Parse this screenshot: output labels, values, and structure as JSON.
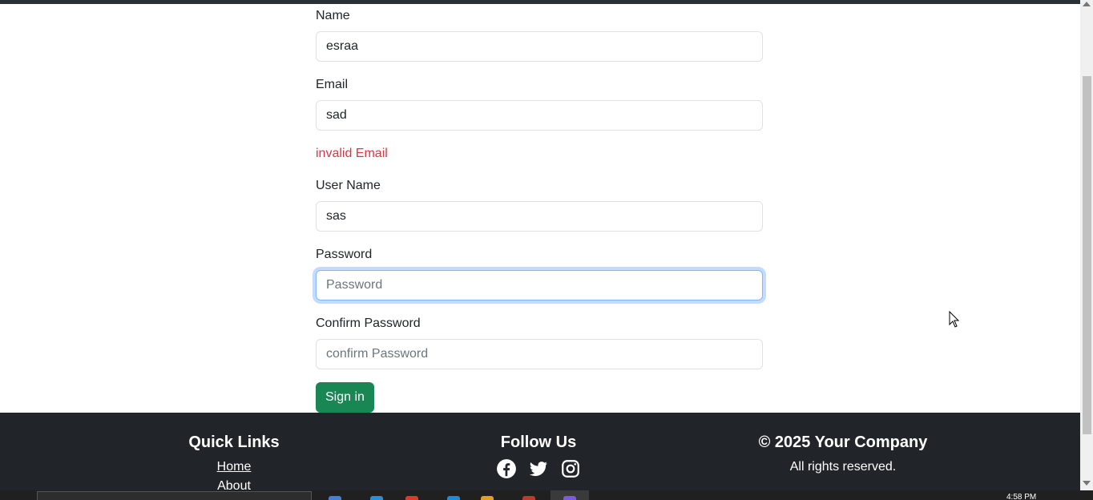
{
  "form": {
    "name_label": "Name",
    "name_value": "esraa",
    "email_label": "Email",
    "email_value": "sad",
    "email_error": "invalid Email",
    "username_label": "User Name",
    "username_value": "sas",
    "password_label": "Password",
    "password_placeholder": "Password",
    "confirm_label": "Confirm Password",
    "confirm_placeholder": "confirm Password",
    "submit_label": "Sign in"
  },
  "footer": {
    "quick_links_title": "Quick Links",
    "links": [
      "Home",
      "About"
    ],
    "follow_title": "Follow Us",
    "social_icons": [
      "facebook-icon",
      "twitter-icon",
      "instagram-icon"
    ],
    "copyright": "© 2025 Your Company",
    "rights": "All rights reserved."
  },
  "taskbar": {
    "time": "4:58 PM"
  },
  "colors": {
    "primary_button": "#198754",
    "error": "#dc3545",
    "footer_bg": "#212529",
    "focus_border": "#86b7fe"
  }
}
